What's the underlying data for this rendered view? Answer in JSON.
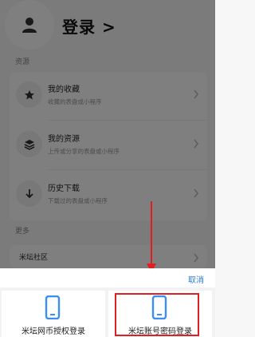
{
  "header": {
    "login_text": "登录 >"
  },
  "sections": {
    "resources_label": "资源",
    "more_label": "更多"
  },
  "resources": [
    {
      "title": "我的收藏",
      "subtitle": "收藏的表盘或小程序",
      "icon": "star-icon"
    },
    {
      "title": "我的资源",
      "subtitle": "上传或分享的表盘或小程序",
      "icon": "layers-icon"
    },
    {
      "title": "历史下载",
      "subtitle": "下载过的表盘或小程序",
      "icon": "download-icon"
    }
  ],
  "more": {
    "community": "米坛社区"
  },
  "sheet": {
    "cancel": "取消",
    "options": [
      {
        "label": "米坛网币授权登录",
        "icon": "phone-icon"
      },
      {
        "label": "米坛账号密码登录",
        "icon": "phone-icon"
      }
    ]
  },
  "colors": {
    "accent": "#2a7ae2",
    "highlight": "#e02020",
    "phone_icon": "#3d8ef2"
  }
}
